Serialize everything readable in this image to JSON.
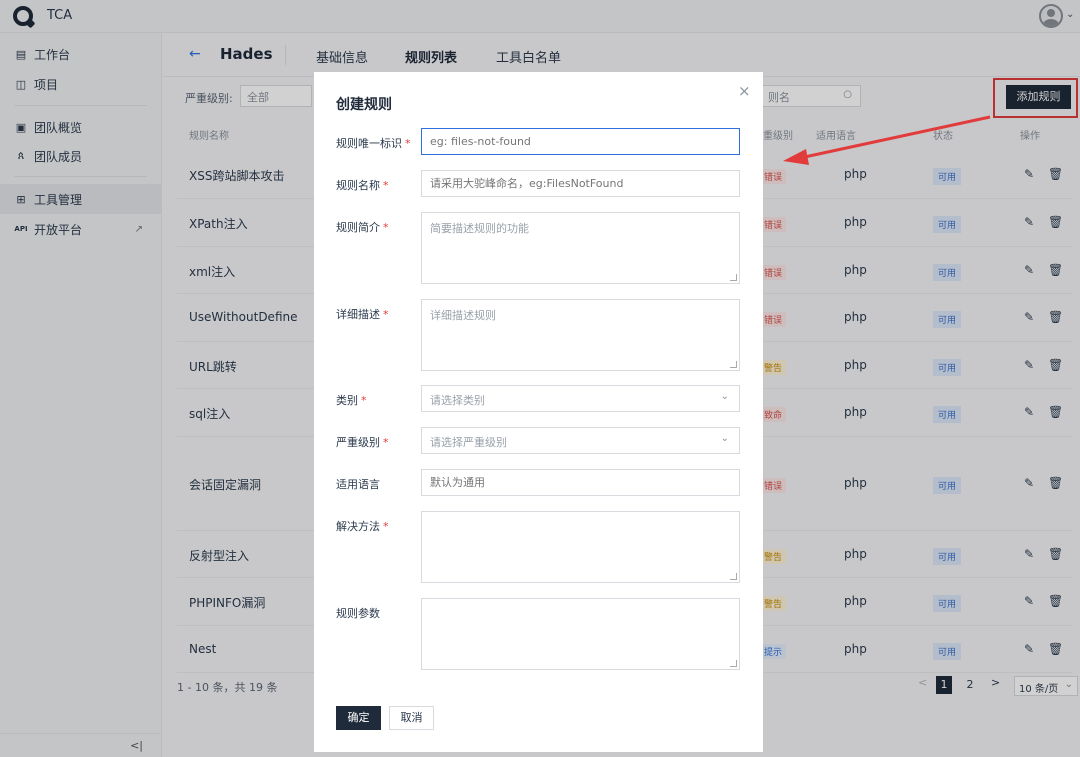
{
  "app": {
    "name": "TCA"
  },
  "sidebar": {
    "items": [
      {
        "icon": "workbench-icon",
        "label": "工作台"
      },
      {
        "icon": "project-icon",
        "label": "项目"
      },
      {
        "icon": "team-overview-icon",
        "label": "团队概览"
      },
      {
        "icon": "team-members-icon",
        "label": "团队成员"
      },
      {
        "icon": "tools-icon",
        "label": "工具管理"
      },
      {
        "icon": "api-icon",
        "label": "开放平台"
      }
    ],
    "api_badge": "API",
    "collapse_symbol": "<|"
  },
  "header": {
    "title": "Hades",
    "tabs": [
      {
        "label": "基础信息"
      },
      {
        "label": "规则列表"
      },
      {
        "label": "工具白名单"
      }
    ]
  },
  "filters": {
    "severity_label": "严重级别:",
    "severity_value": "全部",
    "search_placeholder": "则名"
  },
  "add_rule_button": "添加规则",
  "table": {
    "headers": [
      "规则名称",
      "严重级别",
      "适用语言",
      "状态",
      "操作"
    ],
    "header_severity_partial": "重级别",
    "rows": [
      {
        "name": "XSS跨站脚本攻击",
        "severity": "错误",
        "severity_type": "err",
        "language": "php",
        "status": "可用"
      },
      {
        "name": "XPath注入",
        "severity": "错误",
        "severity_type": "err",
        "language": "php",
        "status": "可用"
      },
      {
        "name": "xml注入",
        "severity": "错误",
        "severity_type": "err",
        "language": "php",
        "status": "可用"
      },
      {
        "name": "UseWithoutDefine",
        "severity": "错误",
        "severity_type": "err",
        "language": "php",
        "status": "可用"
      },
      {
        "name": "URL跳转",
        "severity": "警告",
        "severity_type": "warn",
        "language": "php",
        "status": "可用"
      },
      {
        "name": "sql注入",
        "severity": "致命",
        "severity_type": "fatal",
        "language": "php",
        "status": "可用"
      },
      {
        "name": "会话固定漏洞",
        "severity": "错误",
        "severity_type": "err",
        "language": "php",
        "status": "可用"
      },
      {
        "name": "反射型注入",
        "severity": "警告",
        "severity_type": "warn",
        "language": "php",
        "status": "可用"
      },
      {
        "name": "PHPINFO漏洞",
        "severity": "警告",
        "severity_type": "warn",
        "language": "php",
        "status": "可用"
      },
      {
        "name": "Nest",
        "severity": "提示",
        "severity_type": "hint",
        "language": "php",
        "status": "可用"
      }
    ]
  },
  "pagination": {
    "summary": "1 - 10 条，共 19 条",
    "prev": "<",
    "pages": [
      "1",
      "2"
    ],
    "current": "1",
    "next": ">",
    "page_size": "10 条/页"
  },
  "modal": {
    "title": "创建规则",
    "close": "×",
    "fields": [
      {
        "label": "规则唯一标识",
        "required": true,
        "placeholder": "eg: files-not-found",
        "kind": "input"
      },
      {
        "label": "规则名称",
        "required": true,
        "placeholder": "请采用大驼峰命名，eg:FilesNotFound",
        "kind": "input"
      },
      {
        "label": "规则简介",
        "required": true,
        "placeholder": "简要描述规则的功能",
        "kind": "textarea"
      },
      {
        "label": "详细描述",
        "required": true,
        "placeholder": "详细描述规则",
        "kind": "textarea"
      },
      {
        "label": "类别",
        "required": true,
        "placeholder": "请选择类别",
        "kind": "select"
      },
      {
        "label": "严重级别",
        "required": true,
        "placeholder": "请选择严重级别",
        "kind": "select"
      },
      {
        "label": "适用语言",
        "required": false,
        "placeholder": "默认为通用",
        "kind": "input"
      },
      {
        "label": "解决方法",
        "required": true,
        "placeholder": "",
        "kind": "textarea"
      },
      {
        "label": "规则参数",
        "required": false,
        "placeholder": "",
        "kind": "textarea"
      }
    ],
    "ok": "确定",
    "cancel": "取消"
  },
  "colors": {
    "primary": "#1f2a3a",
    "highlight": "#e23b3b",
    "link": "#2f6fe0"
  }
}
